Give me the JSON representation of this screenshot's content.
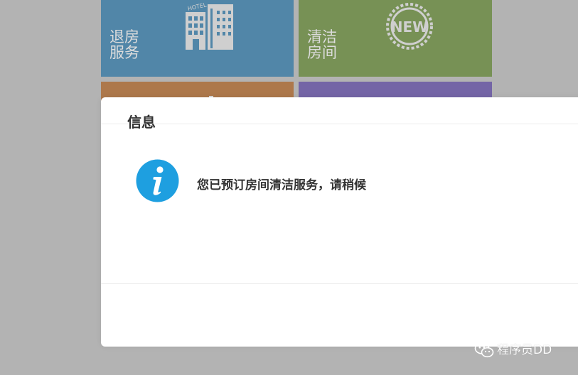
{
  "tiles": {
    "checkout": {
      "label": "退房\n服务",
      "icon": "hotel-building-icon",
      "icon_text": "HOTEL",
      "color": "#5186a8"
    },
    "cleaning": {
      "label": "清洁\n房间",
      "icon": "new-badge-icon",
      "icon_text": "NEW",
      "color": "#779155"
    },
    "orange": {
      "color": "#ad784b"
    },
    "purple": {
      "color": "#7465a6"
    }
  },
  "dialog": {
    "title": "信息",
    "icon": "info-icon",
    "icon_color": "#1e9fe0",
    "message": "您已预订房间清洁服务，请稍候"
  },
  "watermark": {
    "icon": "wechat-icon",
    "text": "程序员DD"
  }
}
